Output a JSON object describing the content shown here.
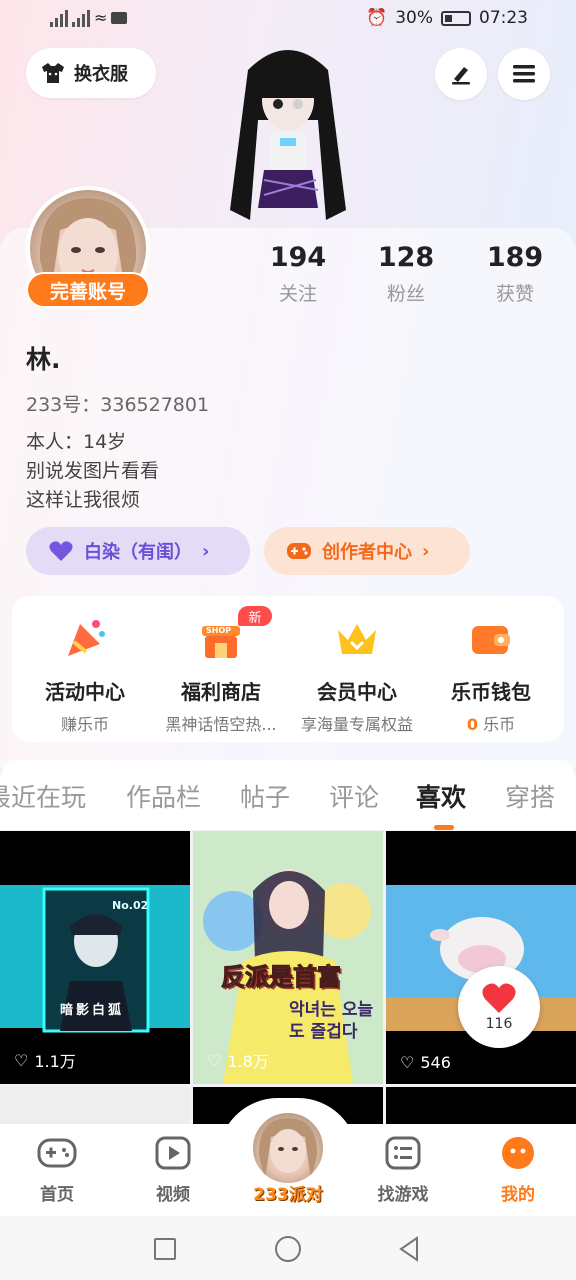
{
  "status_bar": {
    "battery": "30%",
    "time": "07:23"
  },
  "top": {
    "outfit_label": "换衣服"
  },
  "profile": {
    "complete_badge": "完善账号",
    "stats": [
      {
        "num": "194",
        "label": "关注"
      },
      {
        "num": "128",
        "label": "粉丝"
      },
      {
        "num": "189",
        "label": "获赞"
      }
    ],
    "username": "林.",
    "id_text": "233号：336527801",
    "bio": [
      "本人：14岁",
      "别说发图片看看",
      "这样让我很烦"
    ],
    "tag_purple": "白染（有闺）",
    "tag_orange": "创作者中心"
  },
  "services": [
    {
      "title": "活动中心",
      "sub": "赚乐币"
    },
    {
      "title": "福利商店",
      "sub": "黑神话悟空热..."
    },
    {
      "title": "会员中心",
      "sub": "享海量专属权益"
    },
    {
      "title": "乐币钱包",
      "sub_num": "0",
      "sub": "乐币"
    }
  ],
  "new_badge": "新",
  "shop_sign": "SHOP",
  "tabs": [
    "最近在玩",
    "作品栏",
    "帖子",
    "评论",
    "喜欢",
    "穿搭"
  ],
  "grid": [
    {
      "likes": "1.1万",
      "caption": "暗影白狐",
      "badge": "No.02"
    },
    {
      "likes": "1.8万",
      "caption": "反派是首富",
      "caption2": "악녀는 오늘도 즐겁다"
    },
    {
      "likes": "546"
    }
  ],
  "heart_float_count": "116",
  "bottom_nav": {
    "home": "首页",
    "video": "视频",
    "center": "233派对",
    "find_games": "找游戏",
    "mine": "我的"
  }
}
